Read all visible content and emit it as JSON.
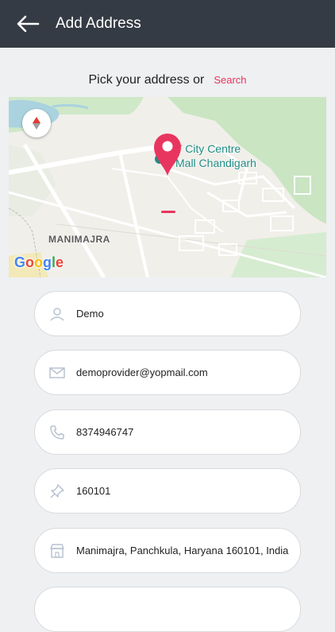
{
  "header": {
    "title": "Add Address",
    "back_icon": "arrow-left-icon"
  },
  "pick": {
    "label": "Pick your address or",
    "search_label": "Search"
  },
  "map": {
    "place_line1": "T City Centre",
    "place_line2": "Mall Chandigarh",
    "area_label": "MANIMAJRA",
    "google_letters": [
      "G",
      "o",
      "o",
      "g",
      "l",
      "e"
    ],
    "google_colors": [
      "#4285F4",
      "#EA4335",
      "#FBBC05",
      "#4285F4",
      "#34A853",
      "#EA4335"
    ],
    "marker_color": "#e8355f"
  },
  "form": {
    "name": {
      "value": "Demo",
      "icon": "user-icon"
    },
    "email": {
      "value": "demoprovider@yopmail.com",
      "icon": "envelope-icon"
    },
    "phone": {
      "value": "8374946747",
      "icon": "phone-icon"
    },
    "pincode": {
      "value": "160101",
      "icon": "pin-icon"
    },
    "address": {
      "value": "Manimajra, Panchkula, Haryana 160101, India",
      "icon": "store-icon"
    }
  },
  "colors": {
    "header_bg": "#353b44",
    "accent": "#e8355f",
    "page_bg": "#eef0f2"
  }
}
